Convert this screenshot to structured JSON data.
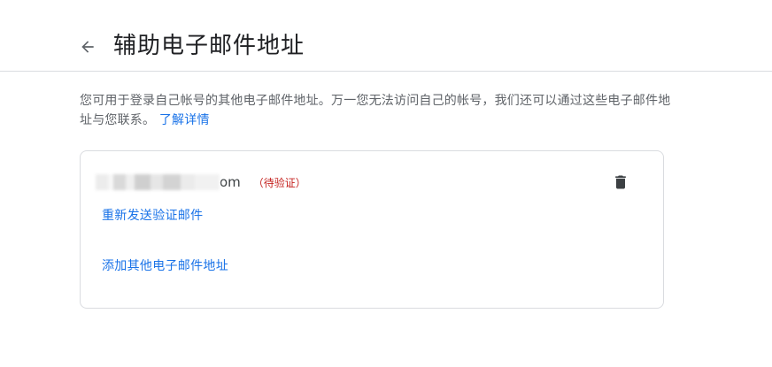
{
  "header": {
    "title": "辅助电子邮件地址",
    "back_icon": "arrow-back-icon"
  },
  "description": {
    "text": "您可用于登录自己帐号的其他电子邮件地址。万一您无法访问自己的帐号，我们还可以通过这些电子邮件地址与您联系。",
    "learn_more": "了解详情"
  },
  "email_card": {
    "email_visible_suffix": "om",
    "status": "（待验证）",
    "delete_icon": "trash-icon",
    "resend_link": "重新发送验证邮件",
    "add_link": "添加其他电子邮件地址"
  },
  "colors": {
    "link": "#1a73e8",
    "pending": "#c5221f",
    "border": "#dadce0"
  }
}
